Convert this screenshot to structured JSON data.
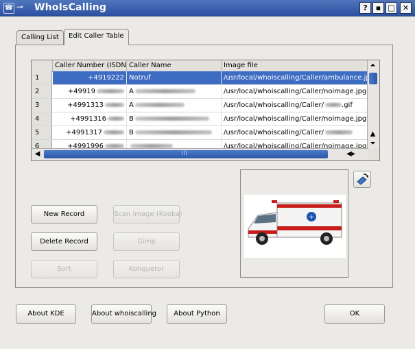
{
  "window": {
    "title": "WhoIsCalling",
    "controls": [
      "?",
      "▪",
      "□",
      "✕"
    ]
  },
  "tabs": [
    {
      "label": "Calling List",
      "active": false
    },
    {
      "label": "Edit Caller Table",
      "active": true
    }
  ],
  "table": {
    "columns": [
      "Caller Number (ISDN)",
      "Caller Name",
      "Image file"
    ],
    "rows": [
      {
        "num": "1",
        "number": "+4919222",
        "name": "Notruf",
        "image": "/usr/local/whoiscalling/Caller/ambulance.jpg",
        "selected": true
      },
      {
        "num": "2",
        "number": "+49919",
        "name": "A",
        "image": "/usr/local/whoiscalling/Caller/noimage.jpg",
        "selected": false
      },
      {
        "num": "3",
        "number": "+4991313",
        "name": "A",
        "image": "/usr/local/whoiscalling/Caller/",
        "image_suffix": ".gif",
        "selected": false
      },
      {
        "num": "4",
        "number": "+4991316",
        "name": "B",
        "image": "/usr/local/whoiscalling/Caller/noimage.jpg",
        "selected": false
      },
      {
        "num": "5",
        "number": "+4991317",
        "name": "B",
        "image": "/usr/local/whoiscalling/Caller/",
        "selected": false
      },
      {
        "num": "6",
        "number": "+4991996",
        "name": "",
        "image": "/usr/local/whoiscalling/Caller/noimage.jpg",
        "selected": false
      }
    ]
  },
  "buttons": {
    "new_record": "New Record",
    "delete_record": "Delete Record",
    "sort": "Sort",
    "scan_image": "Scan image (Kooka)",
    "gimp": "Gimp",
    "konqueror": "Konqueror",
    "about_kde": "About KDE",
    "about_whoiscalling": "About whoiscalling",
    "about_python": "About Python",
    "ok": "OK"
  },
  "colors": {
    "titlebar": "#2c52a0",
    "selection": "#3d6cc3",
    "scroll_thumb": "#2b58a8"
  }
}
